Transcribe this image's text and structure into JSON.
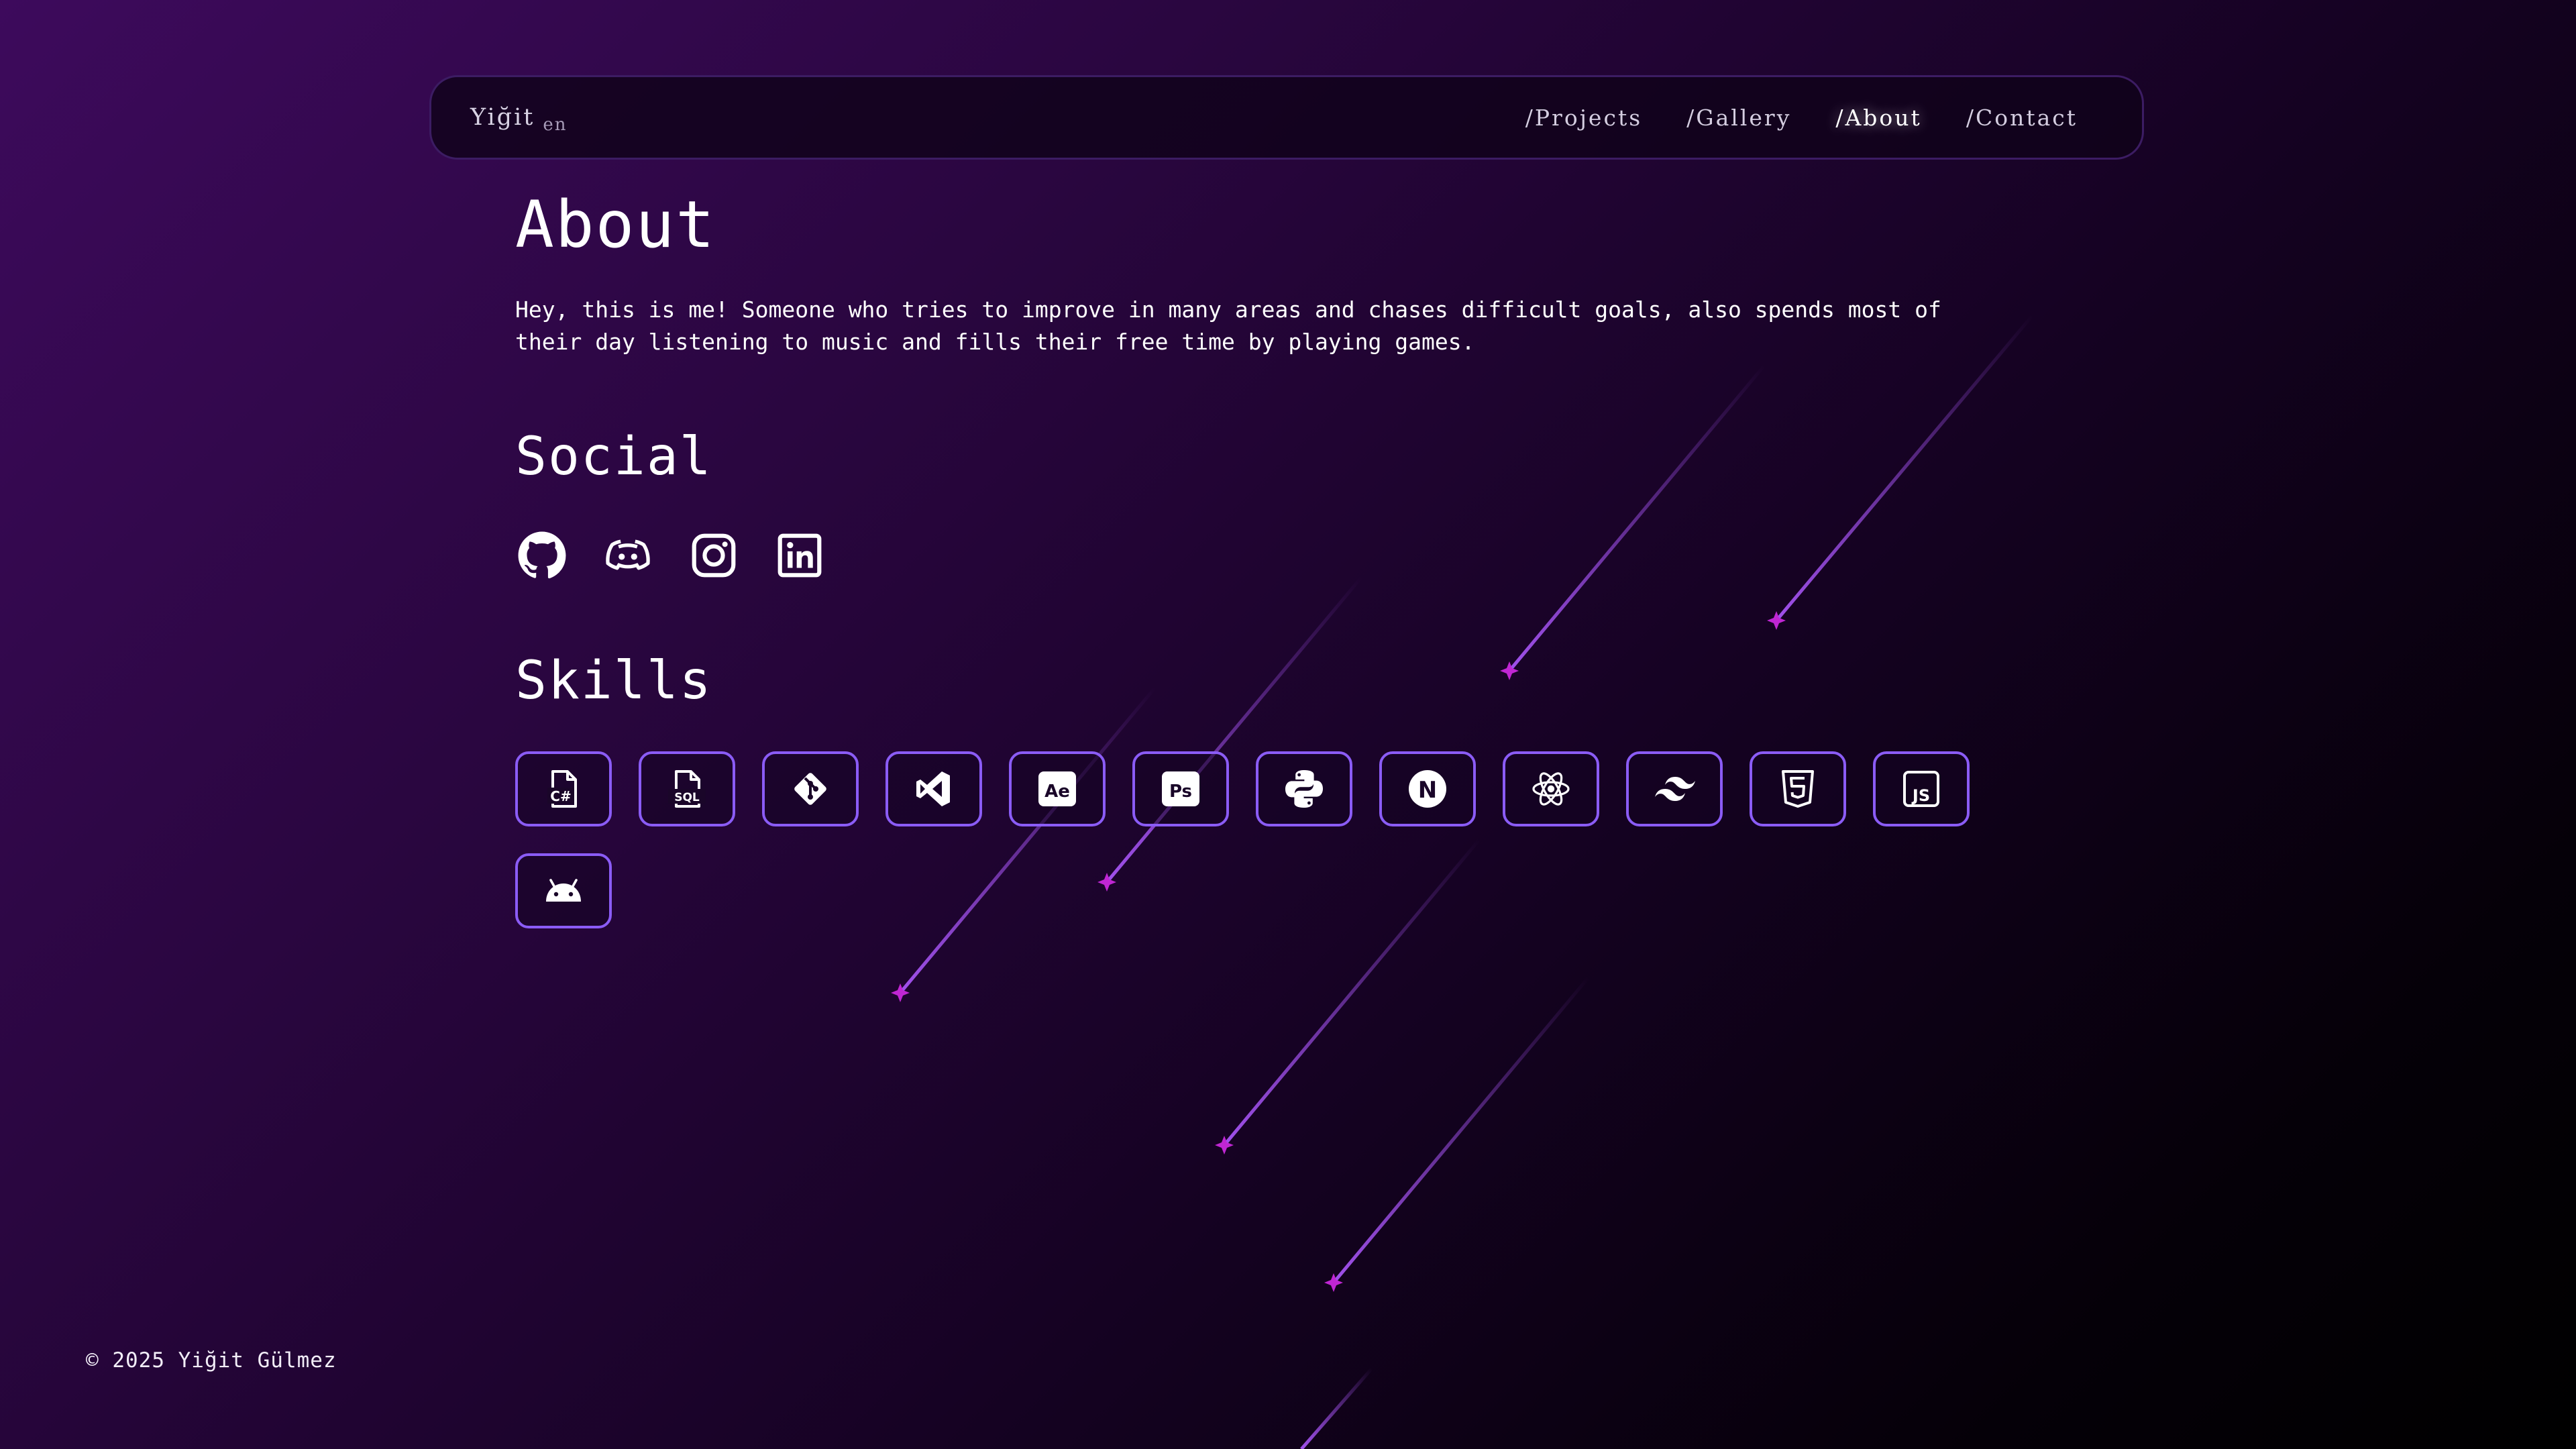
{
  "nav": {
    "brand": "Yiğit",
    "lang": "en",
    "links": [
      {
        "label": "/Projects"
      },
      {
        "label": "/Gallery"
      },
      {
        "label": "/About"
      },
      {
        "label": "/Contact"
      }
    ],
    "active": "/About"
  },
  "about": {
    "title": "About",
    "text": "Hey, this is me! Someone who tries to improve in many areas and chases difficult goals, also spends most of their day listening to music and fills their free time by playing games."
  },
  "social": {
    "title": "Social",
    "icons": [
      "github-icon",
      "discord-icon",
      "instagram-icon",
      "linkedin-icon"
    ]
  },
  "skills": {
    "title": "Skills",
    "icons": [
      "csharp-icon",
      "sql-icon",
      "git-icon",
      "vscode-icon",
      "after-effects-icon",
      "photoshop-icon",
      "python-icon",
      "nextjs-icon",
      "react-icon",
      "tailwind-icon",
      "html5-icon",
      "javascript-icon",
      "android-icon"
    ],
    "labels": {
      "csharp": "C#",
      "sql": "SQL",
      "after_effects": "Ae",
      "photoshop": "Ps",
      "nextjs": "N",
      "javascript": "JS"
    }
  },
  "footer": {
    "copyright": "© 2025 Yiğit Gülmez"
  },
  "colors": {
    "accent": "#8b5cf6",
    "star": "#a020f0",
    "background_top": "#3d0a5c",
    "background_bottom": "#000000"
  }
}
